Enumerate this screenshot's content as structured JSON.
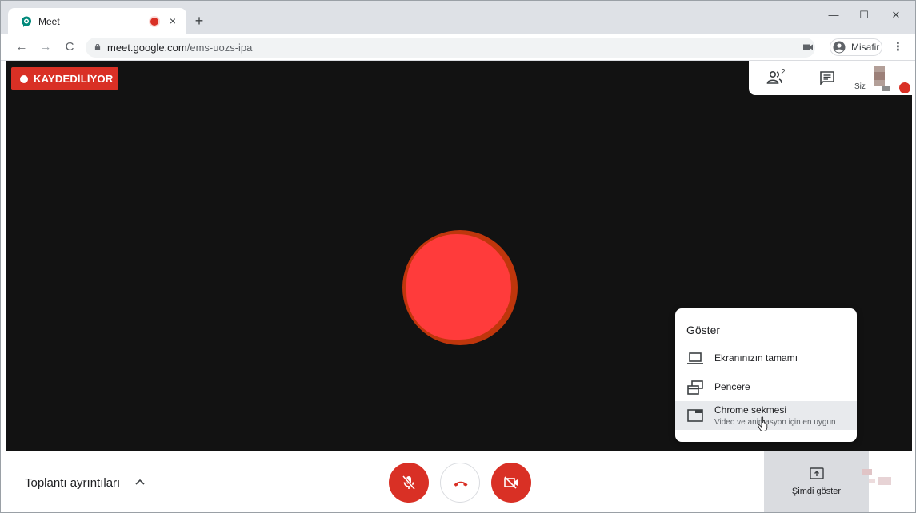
{
  "browser": {
    "tab": {
      "title": "Meet",
      "close": "×"
    },
    "new_tab": "+",
    "window_controls": {
      "minimize": "—",
      "maximize": "☐",
      "close": "✕"
    },
    "nav": {
      "back": "←",
      "forward": "→",
      "reload": "C"
    },
    "url_host": "meet.google.com",
    "url_path": "/ems-uozs-ipa",
    "profile_name": "Misafir",
    "menu": "⋮"
  },
  "meet": {
    "recording_label": "KAYDEDİLİYOR",
    "people_count": "2",
    "self_label": "Siz",
    "present_menu": {
      "title": "Göster",
      "items": [
        {
          "label": "Ekranınızın tamamı"
        },
        {
          "label": "Pencere"
        },
        {
          "label": "Chrome sekmesi",
          "sublabel": "Video ve animasyon için en uygun"
        }
      ]
    },
    "bottom": {
      "details_label": "Toplantı ayrıntıları",
      "present_now_label": "Şimdi göster"
    }
  },
  "colors": {
    "recording_red": "#d93025",
    "stage_bg": "#121212",
    "avatar_fill": "#ff3b3b"
  }
}
